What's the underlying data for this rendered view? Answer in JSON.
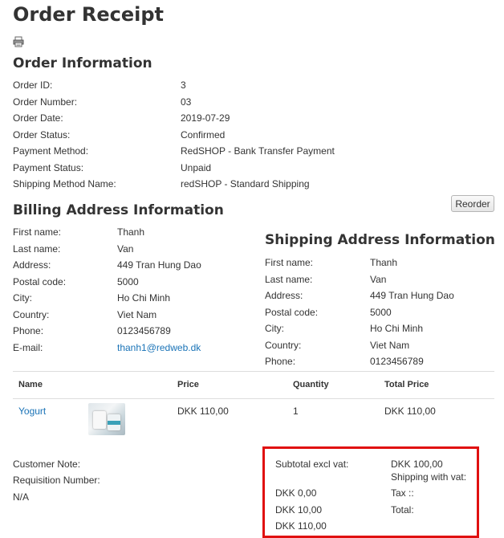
{
  "page_title": "Order Receipt",
  "print_icon": "printer-icon",
  "order_info": {
    "heading": "Order Information",
    "rows": [
      {
        "label": "Order ID:",
        "value": "3"
      },
      {
        "label": "Order Number:",
        "value": "03"
      },
      {
        "label": "Order Date:",
        "value": "2019-07-29"
      },
      {
        "label": "Order Status:",
        "value": "Confirmed"
      },
      {
        "label": "Payment Method:",
        "value": "RedSHOP - Bank Transfer Payment"
      },
      {
        "label": "Payment Status:",
        "value": "Unpaid"
      },
      {
        "label": "Shipping Method Name:",
        "value": "redSHOP - Standard Shipping"
      }
    ]
  },
  "reorder_label": "Reorder",
  "billing": {
    "heading": "Billing Address Information",
    "rows": [
      {
        "label": "First name:",
        "value": "Thanh"
      },
      {
        "label": "Last name:",
        "value": "Van"
      },
      {
        "label": "Address:",
        "value": "449 Tran Hung Dao"
      },
      {
        "label": "Postal code:",
        "value": "5000"
      },
      {
        "label": "City:",
        "value": "Ho Chi Minh"
      },
      {
        "label": "Country:",
        "value": "Viet Nam"
      },
      {
        "label": "Phone:",
        "value": "0123456789"
      },
      {
        "label": "E-mail:",
        "value": "thanh1@redweb.dk"
      }
    ]
  },
  "shipping": {
    "heading": "Shipping Address Information",
    "rows": [
      {
        "label": "First name:",
        "value": "Thanh"
      },
      {
        "label": "Last name:",
        "value": "Van"
      },
      {
        "label": "Address:",
        "value": "449 Tran Hung Dao"
      },
      {
        "label": "Postal code:",
        "value": "5000"
      },
      {
        "label": "City:",
        "value": "Ho Chi Minh"
      },
      {
        "label": "Country:",
        "value": "Viet Nam"
      },
      {
        "label": "Phone:",
        "value": "0123456789"
      }
    ]
  },
  "items_table": {
    "headers": {
      "name": "Name",
      "price": "Price",
      "quantity": "Quantity",
      "total": "Total Price"
    },
    "rows": [
      {
        "name": "Yogurt",
        "price": "DKK 110,00",
        "quantity": "1",
        "total": "DKK 110,00"
      }
    ]
  },
  "notes": {
    "customer_note": "Customer Note:",
    "requisition": "Requisition Number:",
    "requisition_value": "N/A"
  },
  "totals": {
    "subtotal_label": "Subtotal excl vat:",
    "subtotal_value": "DKK 100,00",
    "shipping_label": "Shipping with vat:",
    "shipping_value": "DKK 0,00",
    "tax_label": "Tax ::",
    "tax_value": "DKK 10,00",
    "total_label": "Total:",
    "total_value": "DKK 110,00"
  },
  "colors": {
    "link": "#1a73b7",
    "highlight_border": "#e01010"
  }
}
